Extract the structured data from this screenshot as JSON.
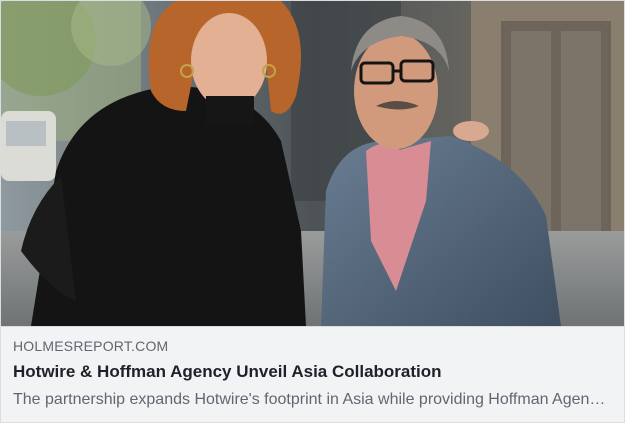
{
  "link_preview": {
    "image_alt": "",
    "domain": "HOLMESREPORT.COM",
    "title": "Hotwire & Hoffman Agency Unveil Asia Collaboration",
    "description": "The partnership expands Hotwire's footprint in Asia while providing Hoffman Agency clients with additional capabilities"
  }
}
